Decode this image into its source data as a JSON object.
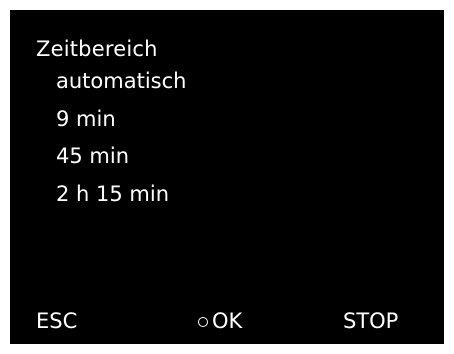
{
  "screen": {
    "title": "Zeitbereich",
    "options": [
      {
        "label": "automatisch"
      },
      {
        "label": "9 min"
      },
      {
        "label": "45 min"
      },
      {
        "label": "2 h 15 min"
      }
    ]
  },
  "softkeys": {
    "esc": "ESC",
    "ok": "OK",
    "ok_icon": "circle-icon",
    "stop": "STOP"
  },
  "colors": {
    "background": "#000000",
    "text": "#ffffff",
    "border": "#ffffff"
  }
}
